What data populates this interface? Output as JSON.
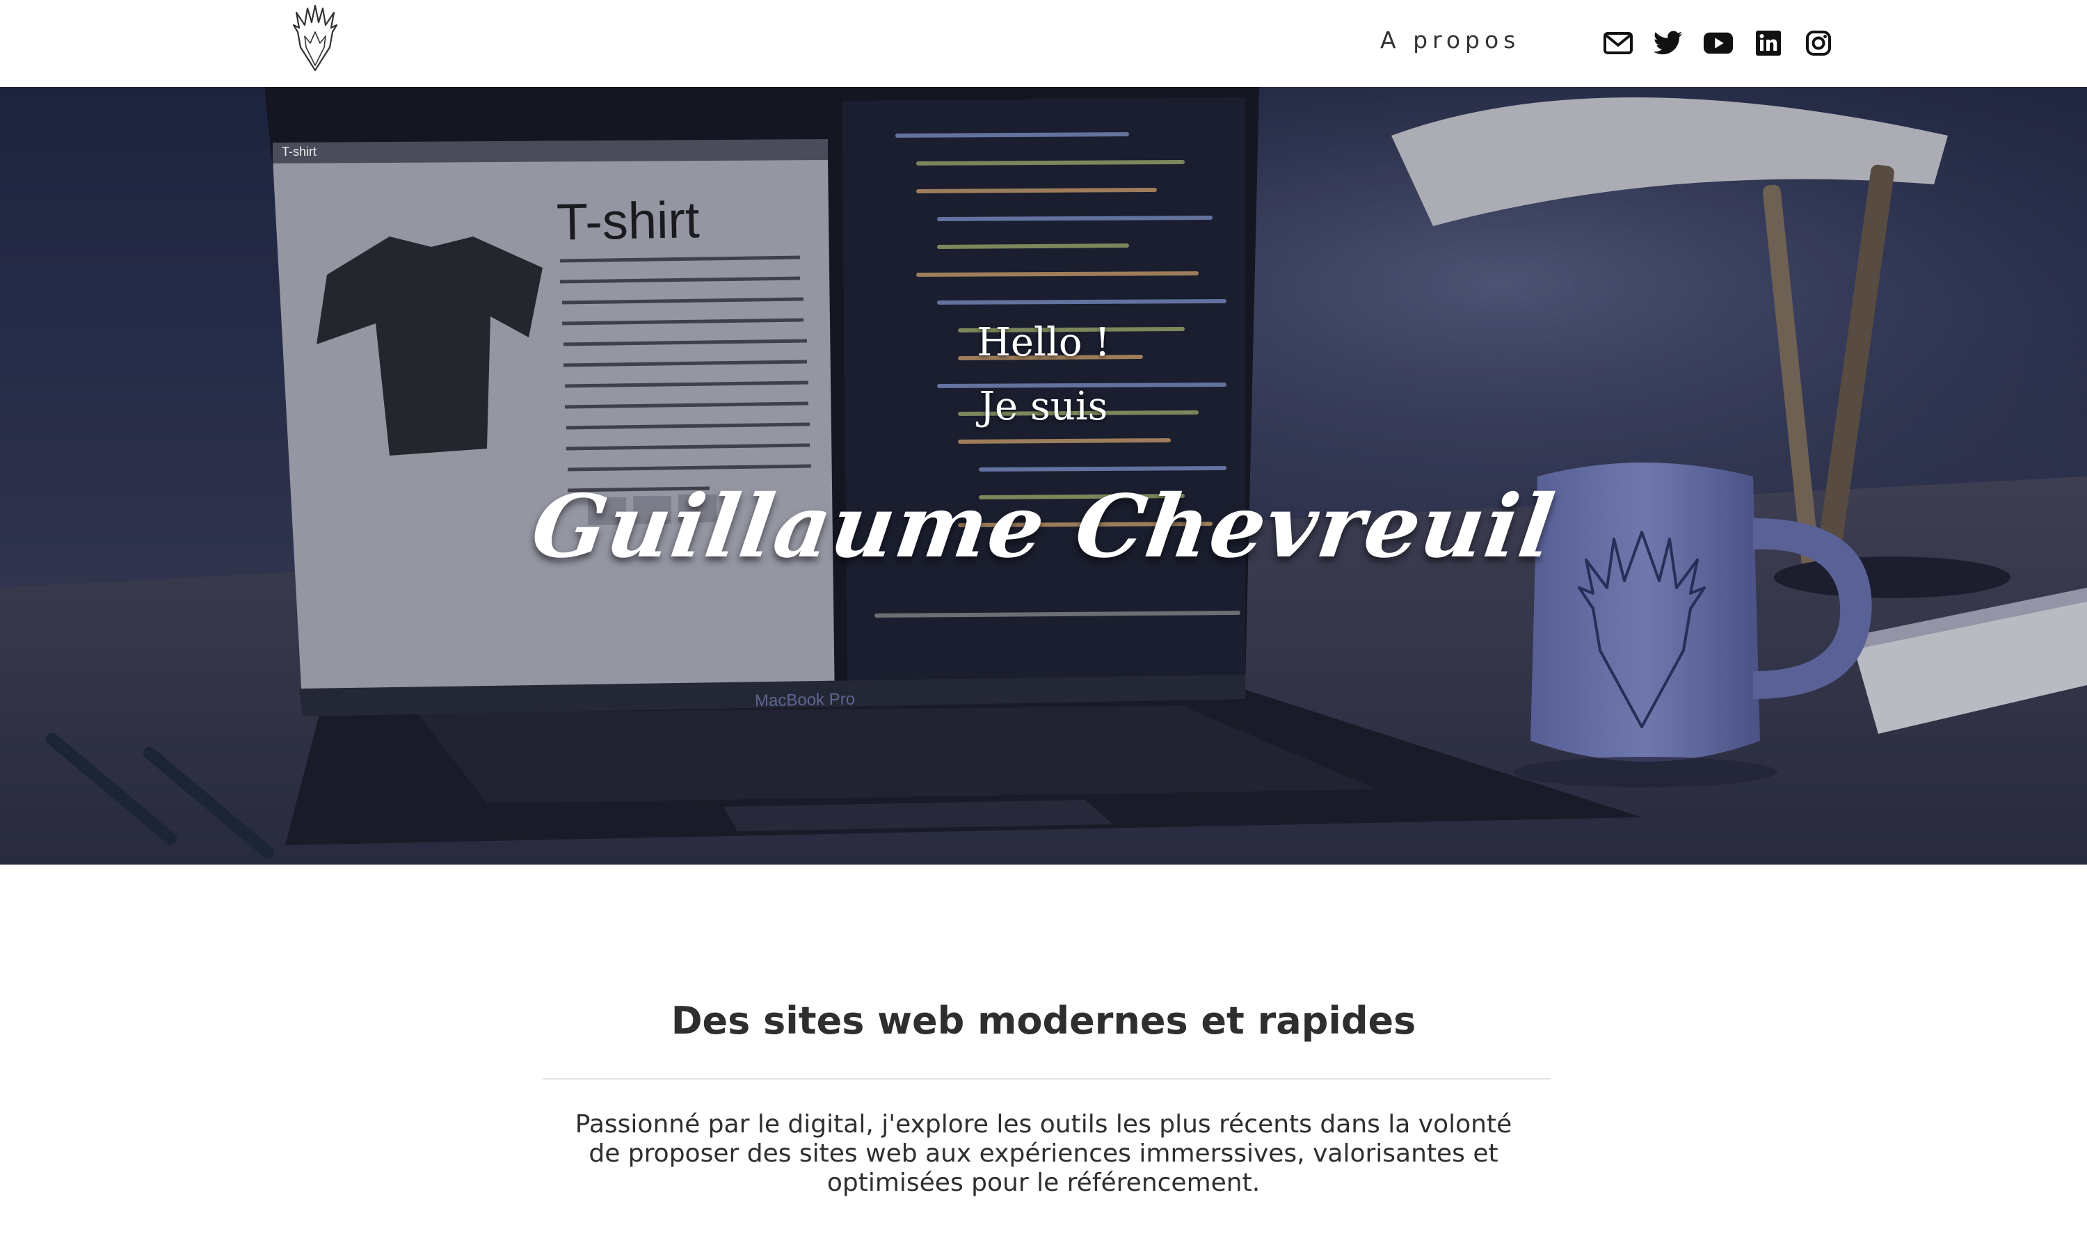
{
  "header": {
    "logo_icon": "flame-crest-logo",
    "nav": {
      "about_label": "A propos"
    },
    "social": [
      {
        "name": "mail-icon"
      },
      {
        "name": "twitter-icon"
      },
      {
        "name": "youtube-icon"
      },
      {
        "name": "linkedin-icon"
      },
      {
        "name": "instagram-icon"
      }
    ]
  },
  "hero": {
    "greeting": "Hello !",
    "intro": "Je suis",
    "name": "Guillaume Chevreuil",
    "screen_title": "T-shirt",
    "tab_label": "T-shirt",
    "laptop_brand": "MacBook Pro"
  },
  "section": {
    "title": "Des sites web modernes et rapides",
    "text": "Passionné par le digital, j'explore les outils les plus récents dans la volonté de proposer des sites web aux expériences immerssives, valorisantes et optimisées pour le référencement."
  },
  "colors": {
    "accent": "#2b3150",
    "text": "#2e2e2e",
    "mug": "#7f89c6"
  }
}
